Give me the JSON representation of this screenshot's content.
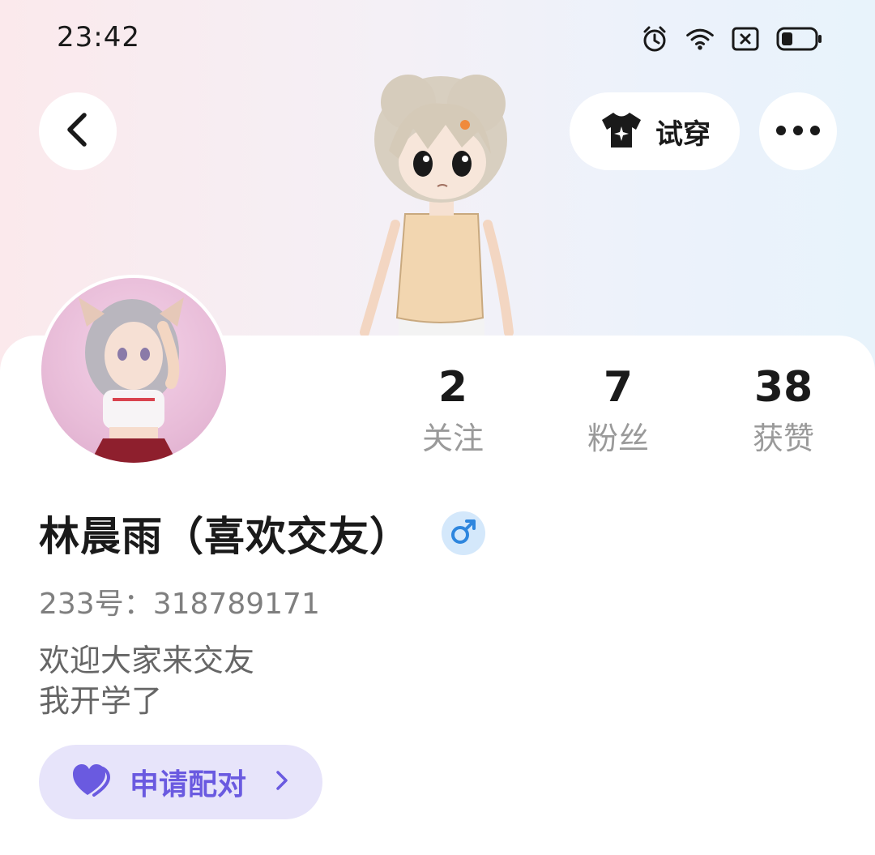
{
  "status_bar": {
    "time": "23:42",
    "icons": [
      "alarm-icon",
      "wifi-icon",
      "sim-off-icon",
      "battery-icon"
    ],
    "battery_level": 0.35
  },
  "header": {
    "back_icon": "chevron-left-icon",
    "try_on_label": "试穿",
    "try_on_icon": "tshirt-icon",
    "more_icon": "more-dots-icon"
  },
  "profile": {
    "name": "林晨雨（喜欢交友）",
    "gender": "male",
    "gender_symbol": "♂",
    "id_label": "233号：",
    "id_value": "318789171",
    "bio_lines": [
      "欢迎大家来交友",
      "我开学了"
    ]
  },
  "stats": [
    {
      "value": "2",
      "label": "关注"
    },
    {
      "value": "7",
      "label": "粉丝"
    },
    {
      "value": "38",
      "label": "获赞"
    }
  ],
  "pair_button": {
    "label": "申请配对",
    "icon": "heart-icon",
    "arrow_icon": "chevron-right-icon"
  },
  "colors": {
    "accent_purple": "#6a5ae0",
    "pair_bg": "#e7e4fa",
    "gender_badge_bg": "#d4e8fb",
    "gender_blue": "#2e86de"
  }
}
